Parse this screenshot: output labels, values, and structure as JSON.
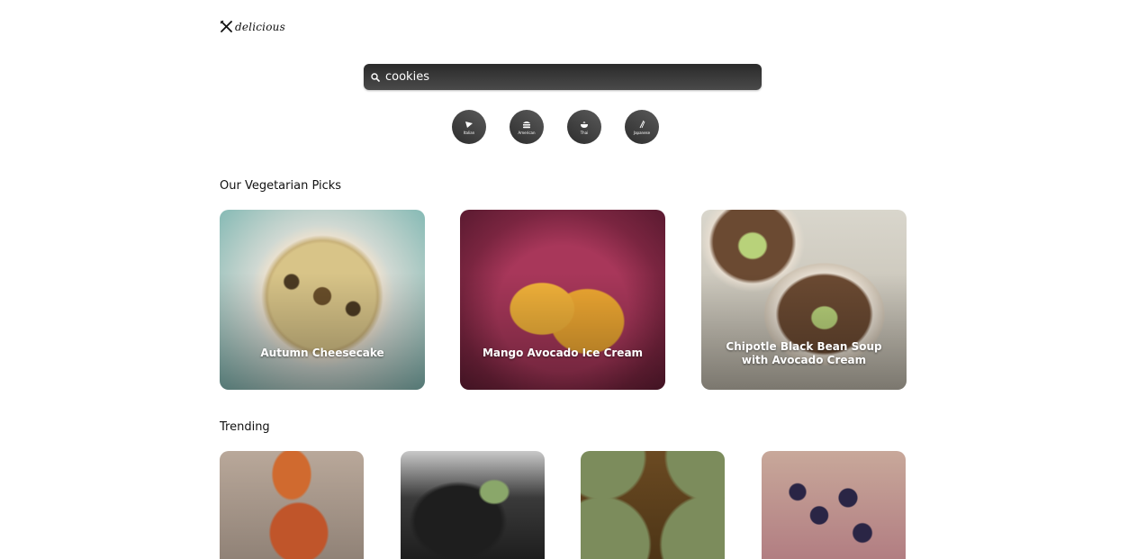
{
  "header": {
    "logo_text": "delicious",
    "logo_icon": "fork-knife-cross-icon"
  },
  "search": {
    "value": "cookies",
    "icon": "search-icon"
  },
  "cuisines": [
    {
      "label": "Italian",
      "icon": "pizza-icon"
    },
    {
      "label": "American",
      "icon": "burger-icon"
    },
    {
      "label": "Thai",
      "icon": "bowl-icon"
    },
    {
      "label": "Japanese",
      "icon": "chopsticks-icon"
    }
  ],
  "vegetarian": {
    "title": "Our Vegetarian Picks",
    "items": [
      {
        "title": "Autumn Cheesecake"
      },
      {
        "title": "Mango Avocado Ice Cream"
      },
      {
        "title": "Chipotle Black Bean Soup with Avocado Cream"
      }
    ]
  },
  "trending": {
    "title": "Trending",
    "items": [
      {
        "alt": "beans dish"
      },
      {
        "alt": "dark dessert"
      },
      {
        "alt": "spinach bowls"
      },
      {
        "alt": "blueberry pastry"
      }
    ]
  }
}
